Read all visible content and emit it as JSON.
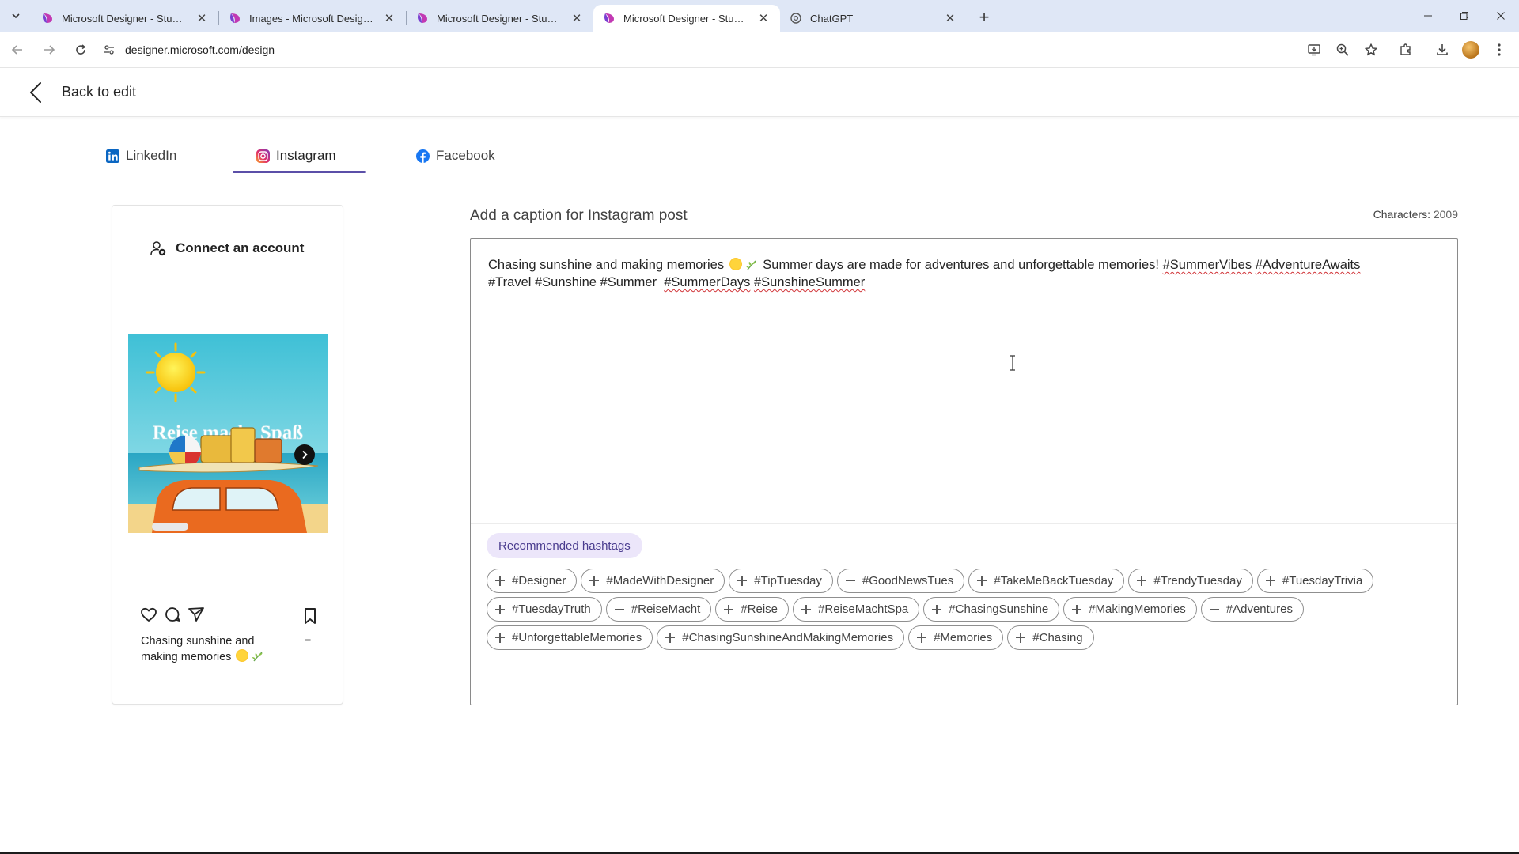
{
  "browser": {
    "tabs": [
      {
        "title": "Microsoft Designer - Stunning designs",
        "active": false
      },
      {
        "title": "Images - Microsoft Designer",
        "active": false
      },
      {
        "title": "Microsoft Designer - Stunning designs",
        "active": false
      },
      {
        "title": "Microsoft Designer - Stunning designs",
        "active": true
      },
      {
        "title": "ChatGPT",
        "active": false
      }
    ],
    "url": "designer.microsoft.com/design"
  },
  "header": {
    "back_label": "Back to edit"
  },
  "platform_tabs": [
    {
      "label": "LinkedIn",
      "icon": "linkedin-icon",
      "active": false
    },
    {
      "label": "Instagram",
      "icon": "instagram-icon",
      "active": true
    },
    {
      "label": "Facebook",
      "icon": "facebook-icon",
      "active": false
    }
  ],
  "preview": {
    "connect_label": "Connect an account",
    "image_text": "Reise macht Spaß",
    "caption_line1": "Chasing sunshine and",
    "caption_line2": "making memories"
  },
  "editor": {
    "title": "Add a caption for Instagram post",
    "char_label": "Characters:",
    "char_count": "2009",
    "caption_part1": "Chasing sunshine and making memories",
    "caption_part2": " Summer days are made for adventures and unforgettable memories! ",
    "caption_tag1": "#SummerVibes",
    "caption_tag2": "#AdventureAwaits",
    "caption_part3": "#Travel #Sunshine #Summer  ",
    "caption_tag3": "#SummerDays",
    "caption_tag4": "#SunshineSummer",
    "recommended_label": "Recommended hashtags"
  },
  "hashtags": [
    [
      "#Designer",
      "#MadeWithDesigner",
      "#TipTuesday",
      "#GoodNewsTues",
      "#TakeMeBackTuesday",
      "#TrendyTuesday",
      "#TuesdayTrivia"
    ],
    [
      "#TuesdayTruth",
      "#ReiseMacht",
      "#Reise",
      "#ReiseMachtSpa",
      "#ChasingSunshine",
      "#MakingMemories",
      "#Adventures"
    ],
    [
      "#UnforgettableMemories",
      "#ChasingSunshineAndMakingMemories",
      "#Memories",
      "#Chasing"
    ]
  ],
  "colors": {
    "accent": "#5b4fa8",
    "chip_label_bg": "#ece6fa",
    "tabstrip_bg": "#dfe7f6"
  }
}
